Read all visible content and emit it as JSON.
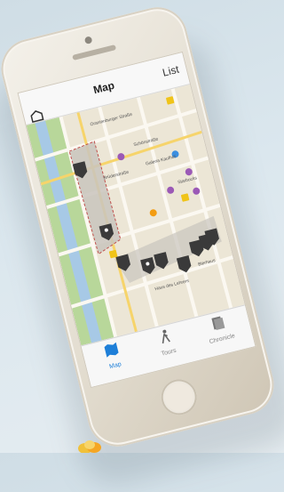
{
  "navbar": {
    "title": "Map",
    "list_label": "List"
  },
  "map": {
    "streets": [
      {
        "label": "Oranienburger Straße"
      },
      {
        "label": "Brüderstraße"
      },
      {
        "label": "Schönstraße"
      },
      {
        "label": "Galeria Kaufhof"
      },
      {
        "label": "Starbucks"
      },
      {
        "label": "Bierhaus"
      },
      {
        "label": "Haus des Lehrers"
      }
    ]
  },
  "tabs": [
    {
      "label": "Map",
      "icon": "map-icon",
      "active": true
    },
    {
      "label": "Tours",
      "icon": "walker-icon",
      "active": false
    },
    {
      "label": "Chronicle",
      "icon": "book-icon",
      "active": false
    }
  ],
  "colors": {
    "accent": "#1e7fd8",
    "pin": "#3a3a3a",
    "route": "#7d7b7b",
    "park": "#b8d79a"
  }
}
